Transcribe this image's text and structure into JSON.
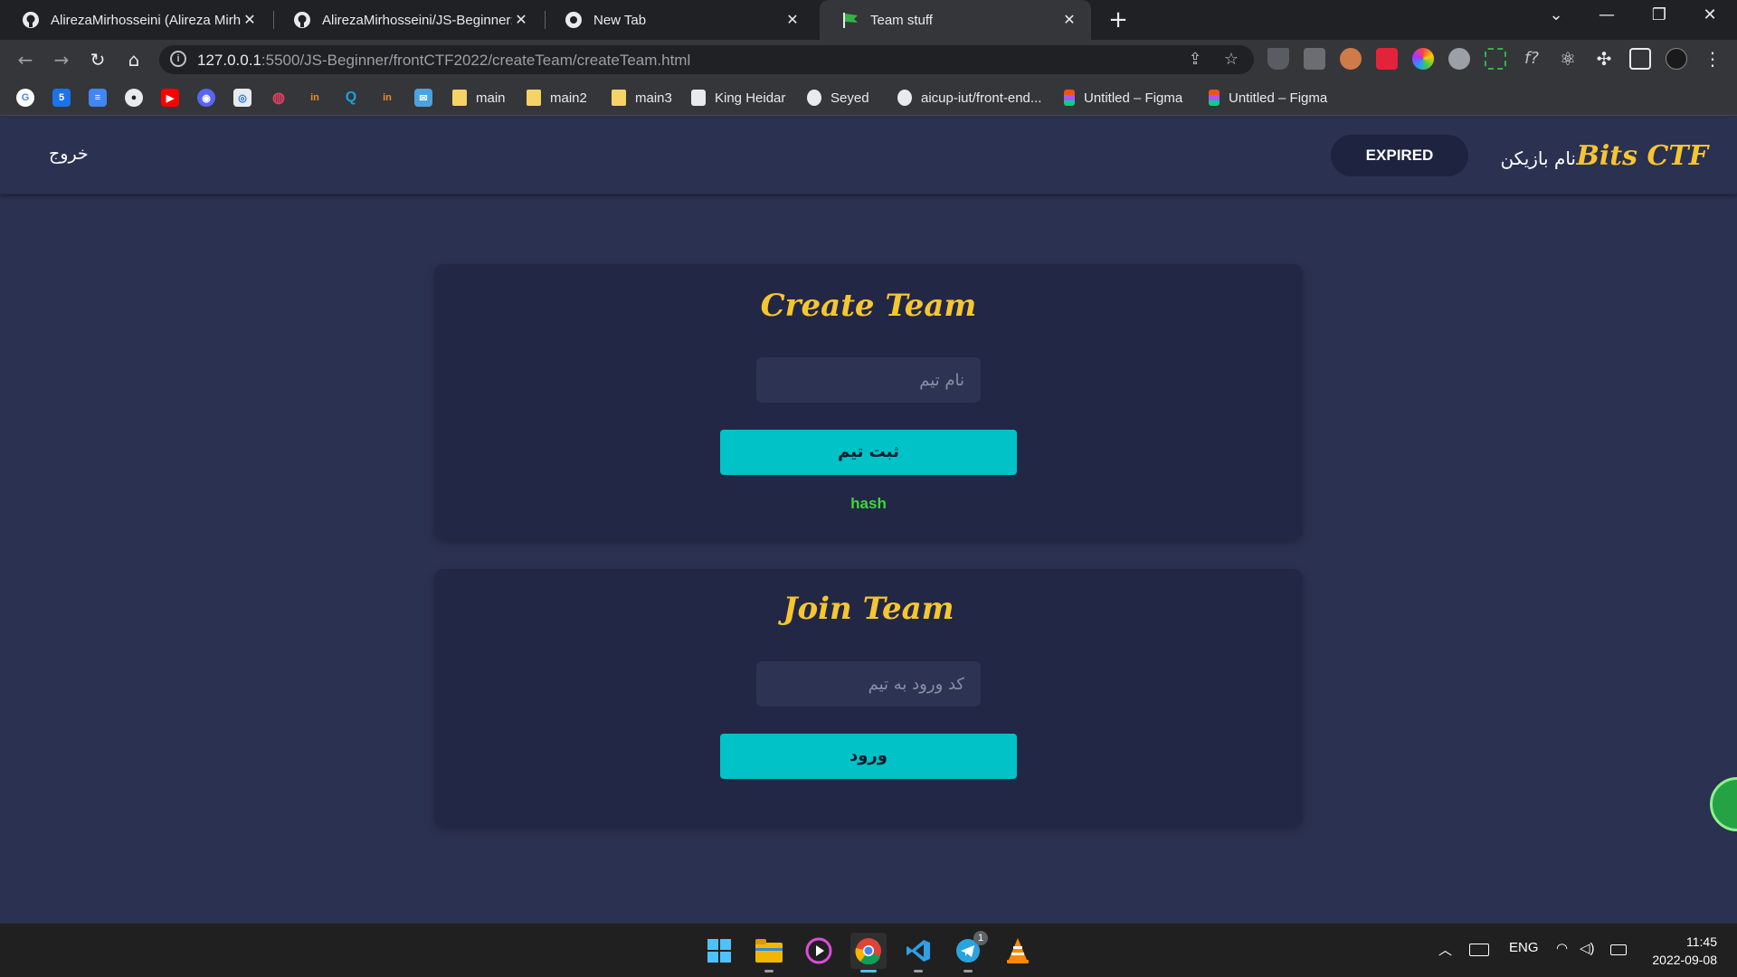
{
  "browser": {
    "tabs": [
      {
        "title": "AlirezaMirhosseini (Alireza Mirhosseini)",
        "icon": "github-icon"
      },
      {
        "title": "AlirezaMirhosseini/JS-Beginner: s",
        "icon": "github-icon"
      },
      {
        "title": "New Tab",
        "icon": "chrome-icon"
      },
      {
        "title": "Team stuff",
        "icon": "flag-icon"
      }
    ],
    "new_tab": "+",
    "window_controls": {
      "list": "⌄",
      "minimize": "—",
      "restore": "❐",
      "close": "✕"
    },
    "url_host": "127.0.0.1",
    "url_rest": ":5500/JS-Beginner/frontCTF2022/createTeam/createTeam.html",
    "bookmarks": [
      {
        "label": "main",
        "icon": "folder-icon"
      },
      {
        "label": "main2",
        "icon": "folder-icon"
      },
      {
        "label": "main3",
        "icon": "folder-icon"
      },
      {
        "label": "King Heidar",
        "icon": "site-icon"
      },
      {
        "label": "Seyed",
        "icon": "github-icon"
      },
      {
        "label": "aicup-iut/front-end...",
        "icon": "github-icon"
      },
      {
        "label": "Untitled – Figma",
        "icon": "figma-icon"
      },
      {
        "label": "Untitled – Figma",
        "icon": "figma-icon"
      }
    ]
  },
  "navbar": {
    "brand": "Bits CTF",
    "player_name": "نام بازیکن",
    "status": "EXPIRED",
    "logout": "خروج"
  },
  "create_team": {
    "title": "Create Team",
    "name_placeholder": "نام تیم",
    "submit_label": "ثبت تیم",
    "hash_text": "hash"
  },
  "join_team": {
    "title": "Join Team",
    "code_placeholder": "کد ورود به تیم",
    "submit_label": "ورود"
  },
  "taskbar": {
    "apps": [
      "windows-start-icon",
      "file-explorer-icon",
      "media-player-icon",
      "chrome-icon",
      "vscode-icon",
      "telegram-icon",
      "vlc-icon"
    ],
    "telegram_badge": "1",
    "language": "ENG",
    "time": "11:45",
    "date": "2022-09-08"
  },
  "colors": {
    "page_bg": "#2b3150",
    "card_bg": "#222745",
    "accent_gold": "#f6c630",
    "button_cyan": "#00c2c7",
    "hash_green": "#3cd63c"
  }
}
